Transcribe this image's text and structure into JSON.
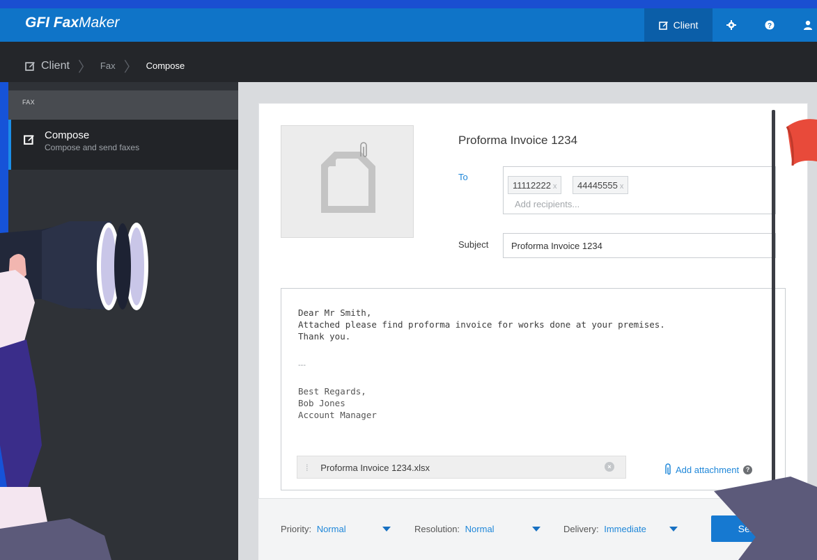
{
  "app": {
    "brand_part1": "GFI",
    "brand_part2": "Fax",
    "brand_part3": "Maker"
  },
  "topnav": {
    "client_label": "Client",
    "icons": [
      "gear-icon",
      "help-icon",
      "user-icon"
    ]
  },
  "breadcrumb": {
    "items": [
      "Client",
      "Fax",
      "Compose"
    ]
  },
  "sidebar": {
    "section_header": "FAX",
    "items": [
      {
        "title": "Compose",
        "subtitle": "Compose and send faxes",
        "icon": "edit-icon"
      }
    ]
  },
  "compose": {
    "fax_title": "Proforma Invoice 1234",
    "to_label": "To",
    "recipients": [
      {
        "number": "11112222",
        "remove": "x"
      },
      {
        "number": "44445555",
        "remove": "x"
      }
    ],
    "recipients_placeholder": "Add recipients...",
    "subject_label": "Subject",
    "subject_value": "Proforma Invoice 1234",
    "body": "Dear Mr Smith,\nAttached please find proforma invoice for works done at your premises.\nThank you.",
    "signature_separator": "---",
    "signature": "Best Regards,\nBob Jones\nAccount Manager",
    "attachment": {
      "filename": "Proforma Invoice 1234.xlsx"
    },
    "add_attachment_label": "Add attachment",
    "help_glyph": "?"
  },
  "options": {
    "priority_label": "Priority:",
    "priority_value": "Normal",
    "resolution_label": "Resolution:",
    "resolution_value": "Normal",
    "delivery_label": "Delivery:",
    "delivery_value": "Immediate",
    "send_label": "Send"
  },
  "colors": {
    "accent": "#0f74c8",
    "link": "#1f87d9",
    "background": "#1a4fd1"
  }
}
